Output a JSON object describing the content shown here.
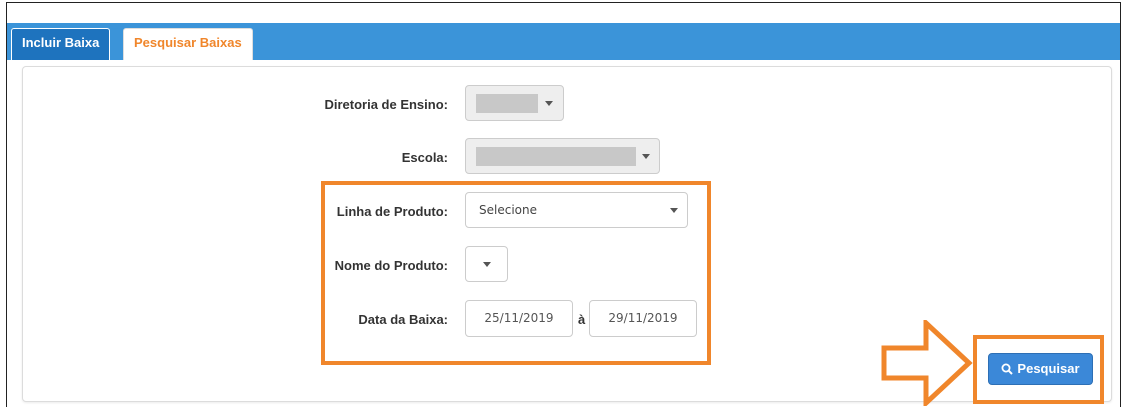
{
  "tabs": [
    {
      "label": "Incluir Baixa",
      "active": true
    },
    {
      "label": "Pesquisar Baixas",
      "active": false
    }
  ],
  "form": {
    "diretoria_label": "Diretoria de Ensino:",
    "escola_label": "Escola:",
    "linha_label": "Linha de Produto:",
    "linha_value": "Selecione",
    "nome_label": "Nome do Produto:",
    "data_label": "Data da Baixa:",
    "date_from": "25/11/2019",
    "date_separator": "à",
    "date_to": "29/11/2019"
  },
  "search_button": {
    "label": "Pesquisar",
    "icon": "search-icon"
  },
  "colors": {
    "accent": "#f0862b",
    "tab_bar": "#3b94d9",
    "button": "#3b88d8"
  }
}
